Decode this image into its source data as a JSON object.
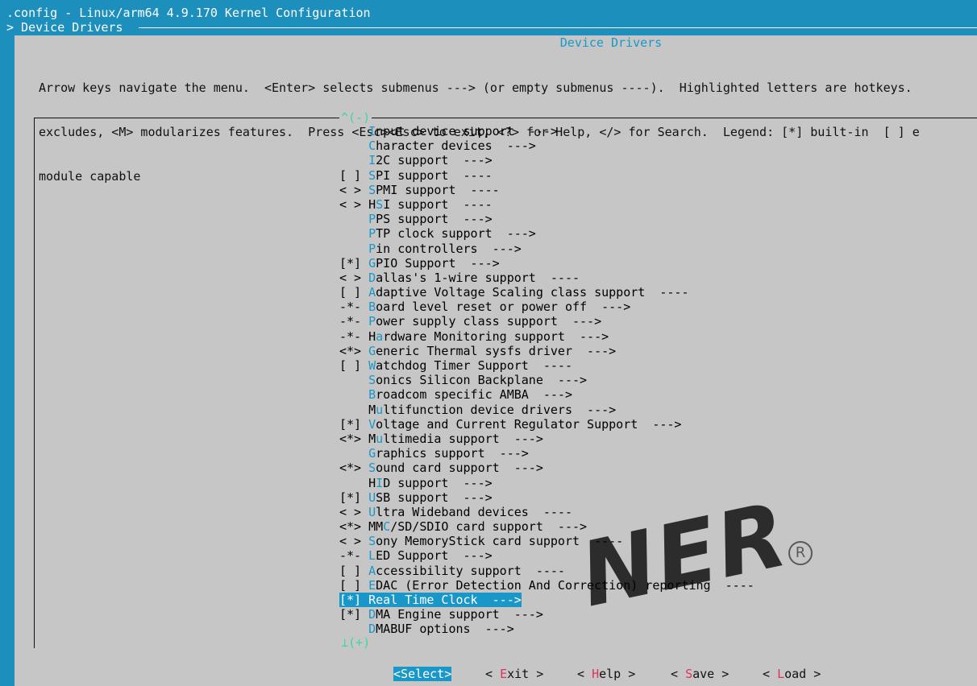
{
  "window": {
    "title": ".config - Linux/arm64 4.9.170 Kernel Configuration",
    "breadcrumb": "> Device Drivers"
  },
  "panel": {
    "title": "Device Drivers",
    "help_lines": [
      "Arrow keys navigate the menu.  <Enter> selects submenus ---> (or empty submenus ----).  Highlighted letters are hotkeys.",
      "excludes, <M> modularizes features.  Press <Esc><Esc> to exit, <?> for Help, </> for Search.  Legend: [*] built-in  [ ] e",
      "module capable"
    ]
  },
  "menu": {
    "scroll_top": "^(-)",
    "scroll_bottom": "⊥(+)",
    "items": [
      {
        "flag": "    ",
        "hk": "I",
        "rest": "nput device support  --->"
      },
      {
        "flag": "    ",
        "hk": "C",
        "rest": "haracter devices  --->"
      },
      {
        "flag": "    ",
        "pre": "",
        "hk": "I",
        "rest": "2C support  --->"
      },
      {
        "flag": "[ ] ",
        "hk": "S",
        "rest": "PI support  ----"
      },
      {
        "flag": "< > ",
        "hk": "S",
        "rest": "PMI support  ----"
      },
      {
        "flag": "< > ",
        "pre": "H",
        "hk": "S",
        "rest": "I support  ----"
      },
      {
        "flag": "    ",
        "hk": "P",
        "rest": "PS support  --->"
      },
      {
        "flag": "    ",
        "hk": "P",
        "rest": "TP clock support  --->"
      },
      {
        "flag": "    ",
        "hk": "P",
        "rest": "in controllers  --->"
      },
      {
        "flag": "[*] ",
        "hk": "G",
        "rest": "PIO Support  --->"
      },
      {
        "flag": "< > ",
        "hk": "D",
        "rest": "allas's 1-wire support  ----"
      },
      {
        "flag": "[ ] ",
        "hk": "A",
        "rest": "daptive Voltage Scaling class support  ----"
      },
      {
        "flag": "-*- ",
        "hk": "B",
        "rest": "oard level reset or power off  --->"
      },
      {
        "flag": "-*- ",
        "hk": "P",
        "rest": "ower supply class support  --->"
      },
      {
        "flag": "-*- ",
        "pre": "H",
        "hk": "a",
        "rest": "rdware Monitoring support  --->"
      },
      {
        "flag": "<*> ",
        "hk": "G",
        "rest": "eneric Thermal sysfs driver  --->"
      },
      {
        "flag": "[ ] ",
        "hk": "W",
        "rest": "atchdog Timer Support  ----"
      },
      {
        "flag": "    ",
        "hk": "S",
        "rest": "onics Silicon Backplane  --->"
      },
      {
        "flag": "    ",
        "hk": "B",
        "rest": "roadcom specific AMBA  --->"
      },
      {
        "flag": "    ",
        "pre": "M",
        "hk": "u",
        "rest": "ltifunction device drivers  --->"
      },
      {
        "flag": "[*] ",
        "hk": "V",
        "rest": "oltage and Current Regulator Support  --->"
      },
      {
        "flag": "<*> ",
        "pre": "M",
        "hk": "u",
        "rest": "ltimedia support  --->"
      },
      {
        "flag": "    ",
        "hk": "G",
        "rest": "raphics support  --->"
      },
      {
        "flag": "<*> ",
        "hk": "S",
        "rest": "ound card support  --->"
      },
      {
        "flag": "    ",
        "pre": "H",
        "hk": "I",
        "rest": "D support  --->"
      },
      {
        "flag": "[*] ",
        "hk": "U",
        "rest": "SB support  --->"
      },
      {
        "flag": "< > ",
        "hk": "U",
        "rest": "ltra Wideband devices  ----"
      },
      {
        "flag": "<*> ",
        "pre": "MM",
        "hk": "C",
        "rest": "/SD/SDIO card support  --->"
      },
      {
        "flag": "< > ",
        "hk": "S",
        "rest": "ony MemoryStick card support  ----"
      },
      {
        "flag": "-*- ",
        "hk": "L",
        "rest": "ED Support  --->"
      },
      {
        "flag": "[ ] ",
        "hk": "A",
        "rest": "ccessibility support  ----"
      },
      {
        "flag": "[ ] ",
        "hk": "E",
        "rest": "DAC (Error Detection And Correction) reporting  ----"
      },
      {
        "flag": "[*] ",
        "hk": "R",
        "rest": "eal Time Clock  --->",
        "selected": true
      },
      {
        "flag": "[*] ",
        "hk": "D",
        "rest": "MA Engine support  --->"
      },
      {
        "flag": "    ",
        "hk": "D",
        "rest": "MABUF options  --->"
      }
    ]
  },
  "buttons": [
    {
      "pre": "<",
      "hk": "S",
      "rest": "elect>",
      "name": "select-button",
      "active": true
    },
    {
      "pre": "< ",
      "hk": "E",
      "rest": "xit >",
      "name": "exit-button"
    },
    {
      "pre": "< ",
      "hk": "H",
      "rest": "elp >",
      "name": "help-button"
    },
    {
      "pre": "< ",
      "hk": "S",
      "rest": "ave >",
      "name": "save-button"
    },
    {
      "pre": "< ",
      "hk": "L",
      "rest": "oad >",
      "name": "load-button"
    }
  ],
  "watermark": {
    "text": "NER",
    "mark": "R"
  },
  "colors": {
    "background": "#1d8fbd",
    "panel": "#c6c6c6",
    "hotkey": "#1a97c9",
    "button_hotkey": "#e0335b",
    "scroll_indicator": "#3fd4a6"
  }
}
